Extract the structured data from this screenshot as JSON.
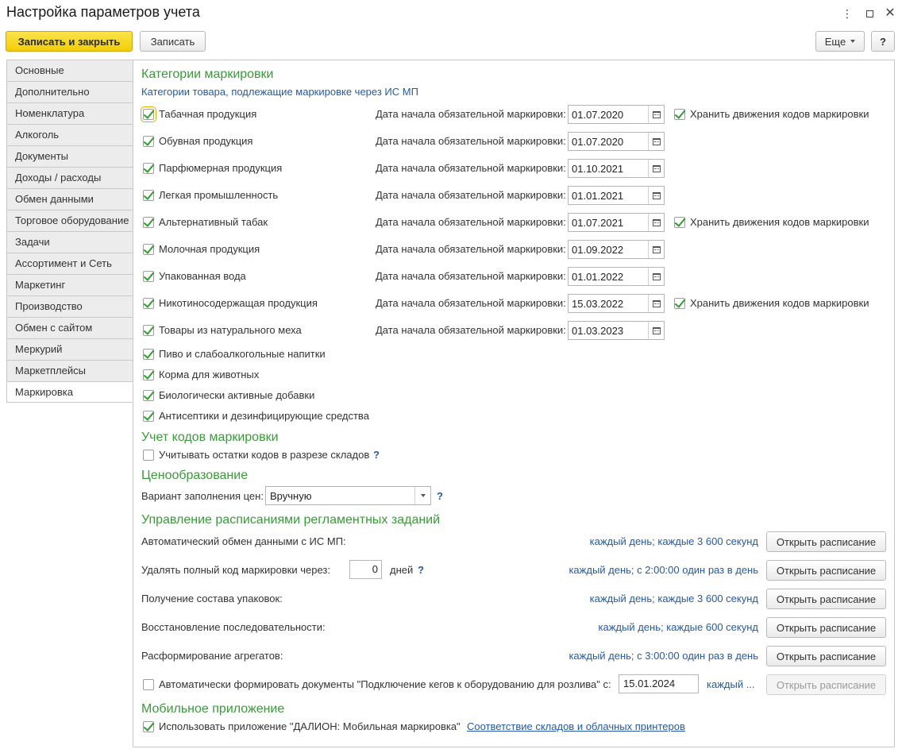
{
  "window": {
    "title": "Настройка параметров учета",
    "menu_icon": "more-vert-icon",
    "maximize_icon": "maximize-icon",
    "close_icon": "close-icon"
  },
  "toolbar": {
    "save_close_label": "Записать и закрыть",
    "save_label": "Записать",
    "more_label": "Еще",
    "help_label": "?"
  },
  "tabs": [
    {
      "label": "Основные"
    },
    {
      "label": "Дополнительно"
    },
    {
      "label": "Номенклатура"
    },
    {
      "label": "Алкоголь"
    },
    {
      "label": "Документы"
    },
    {
      "label": "Доходы / расходы"
    },
    {
      "label": "Обмен данными"
    },
    {
      "label": "Торговое оборудование"
    },
    {
      "label": "Задачи"
    },
    {
      "label": "Ассортимент и Сеть"
    },
    {
      "label": "Маркетинг"
    },
    {
      "label": "Производство"
    },
    {
      "label": "Обмен с сайтом"
    },
    {
      "label": "Меркурий"
    },
    {
      "label": "Маркетплейсы"
    },
    {
      "label": "Маркировка"
    }
  ],
  "marking": {
    "title": "Категории маркировки",
    "subtitle": "Категории товара, подлежащие маркировке через ИС МП",
    "date_label": "Дата начала обязательной маркировки:",
    "store_label": "Хранить движения кодов маркировки",
    "categories": [
      {
        "label": "Табачная продукция",
        "checked": true,
        "date": "01.07.2020",
        "store": true
      },
      {
        "label": "Обувная продукция",
        "checked": true,
        "date": "01.07.2020",
        "store": false
      },
      {
        "label": "Парфюмерная продукция",
        "checked": true,
        "date": "01.10.2021",
        "store": false
      },
      {
        "label": "Легкая промышленность",
        "checked": true,
        "date": "01.01.2021",
        "store": false
      },
      {
        "label": "Альтернативный табак",
        "checked": true,
        "date": "01.07.2021",
        "store": true
      },
      {
        "label": "Молочная продукция",
        "checked": true,
        "date": "01.09.2022",
        "store": false
      },
      {
        "label": "Упакованная вода",
        "checked": true,
        "date": "01.01.2022",
        "store": false
      },
      {
        "label": "Никотиносодержащая продукция",
        "checked": true,
        "date": "15.03.2022",
        "store": true
      },
      {
        "label": "Товары из натурального меха",
        "checked": true,
        "date": "01.03.2023",
        "store": false
      },
      {
        "label": "Пиво и слабоалкогольные напитки",
        "checked": true
      },
      {
        "label": "Корма для животных",
        "checked": true
      },
      {
        "label": "Биологически активные добавки",
        "checked": true
      },
      {
        "label": "Антисептики и дезинфицирующие средства",
        "checked": true
      }
    ]
  },
  "codes": {
    "title": "Учет кодов маркировки",
    "warehouse_label": "Учитывать остатки кодов в разрезе складов",
    "warehouse_checked": false,
    "help": "?"
  },
  "pricing": {
    "title": "Ценообразование",
    "label": "Вариант заполнения цен:",
    "value": "Вручную",
    "help": "?"
  },
  "schedule": {
    "title": "Управление расписаниями регламентных заданий",
    "button_label": "Открыть расписание",
    "days_label": "дней",
    "days_value": "0",
    "help": "?",
    "rows": [
      {
        "label": "Автоматический обмен данными с ИС МП:",
        "schedule": "каждый день; каждые 3 600 секунд"
      },
      {
        "label": "Удалять полный код маркировки через:",
        "schedule": "каждый день; с 2:00:00 один раз в день"
      },
      {
        "label": "Получение состава упаковок:",
        "schedule": "каждый день; каждые 3 600 секунд"
      },
      {
        "label": "Восстановление последовательности:",
        "schedule": "каждый день; каждые 600 секунд"
      },
      {
        "label": "Расформирование агрегатов:",
        "schedule": "каждый день; с 3:00:00 один раз в день"
      }
    ],
    "kegs": {
      "label": "Автоматически формировать документы \"Подключение кегов к оборудованию для розлива\" с:",
      "checked": false,
      "date": "15.01.2024",
      "schedule": "каждый ..."
    }
  },
  "mobile": {
    "title": "Мобильное приложение",
    "label": "Использовать приложение \"ДАЛИОН: Мобильная маркировка\"",
    "checked": true,
    "link": "Соответствие складов и облачных принтеров"
  }
}
